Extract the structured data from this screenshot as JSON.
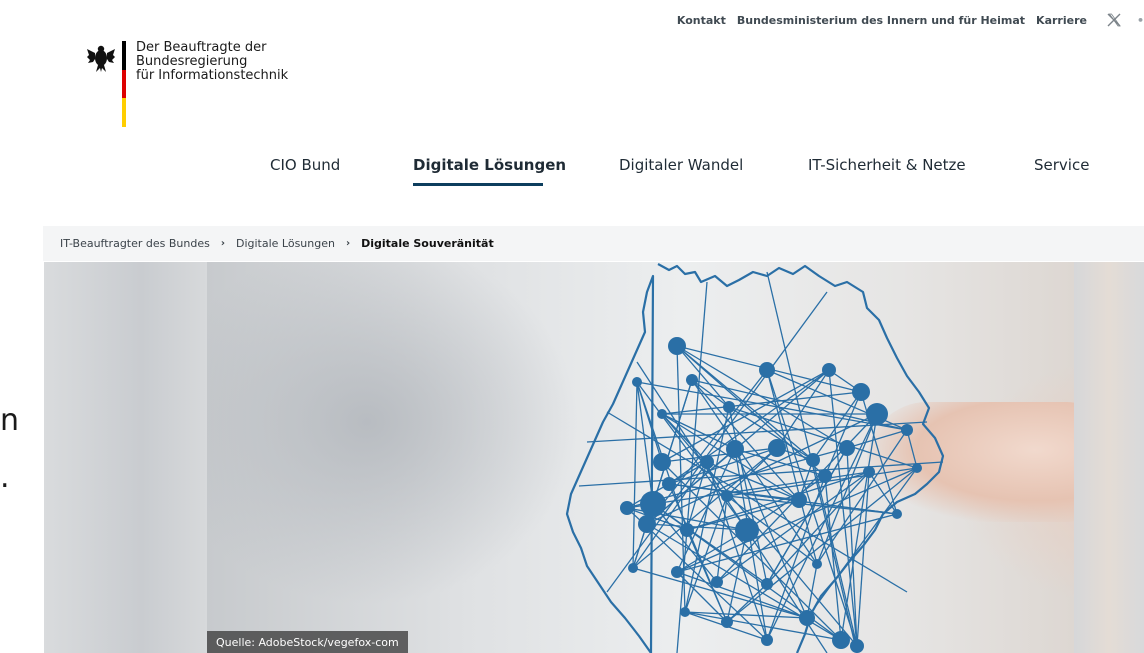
{
  "meta_nav": {
    "items": [
      "Kontakt",
      "Bundesministerium des Innern und für Heimat",
      "Karriere"
    ],
    "x_icon": "x-logo-icon",
    "more_icon": "more-icon"
  },
  "logo": {
    "lines": [
      "Der Beauftragte der",
      "Bundesregierung",
      "für Informationstechnik"
    ],
    "emblem_icon": "federal-eagle-icon",
    "flag_colors": [
      "#000000",
      "#dd0000",
      "#ffce00"
    ]
  },
  "main_nav": {
    "items": [
      "CIO Bund",
      "Digitale Lösungen",
      "Digitaler Wandel",
      "IT-Sicherheit & Netze",
      "Service"
    ],
    "active_index": 1,
    "accent": "#0d3e5e"
  },
  "breadcrumb": {
    "items": [
      "IT-Beauftragter des Bundes",
      "Digitale Lösungen"
    ],
    "current": "Digitale Souveränität",
    "separator": "›"
  },
  "hero": {
    "caption": "Quelle: AdobeStock/vegefox-com",
    "network_color": "#2a6fa6",
    "left_edge_fragments": [
      "n",
      "."
    ]
  }
}
